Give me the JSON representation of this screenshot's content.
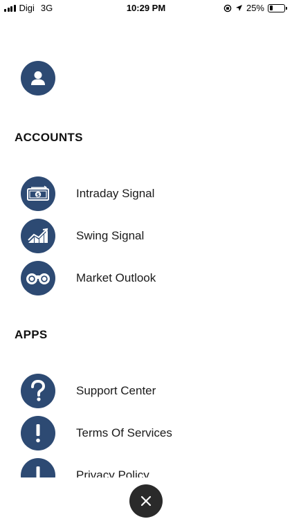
{
  "status_bar": {
    "carrier": "Digi",
    "network": "3G",
    "time": "10:29 PM",
    "battery": "25%",
    "battery_level": 0.25
  },
  "profile": {
    "icon": "user-icon"
  },
  "accounts": {
    "title": "ACCOUNTS",
    "items": [
      {
        "label": "Intraday Signal",
        "icon": "money-icon"
      },
      {
        "label": "Swing Signal",
        "icon": "chart-up-icon"
      },
      {
        "label": "Market Outlook",
        "icon": "binoculars-icon"
      }
    ]
  },
  "apps": {
    "title": "APPS",
    "items": [
      {
        "label": "Support Center",
        "icon": "question-icon"
      },
      {
        "label": "Terms Of Services",
        "icon": "exclamation-icon"
      },
      {
        "label": "Privacy Policy",
        "icon": "exclamation-icon"
      }
    ]
  },
  "close": {
    "icon": "close-icon"
  },
  "colors": {
    "accent": "#2d4a73",
    "close_button": "#2a2a2a"
  }
}
